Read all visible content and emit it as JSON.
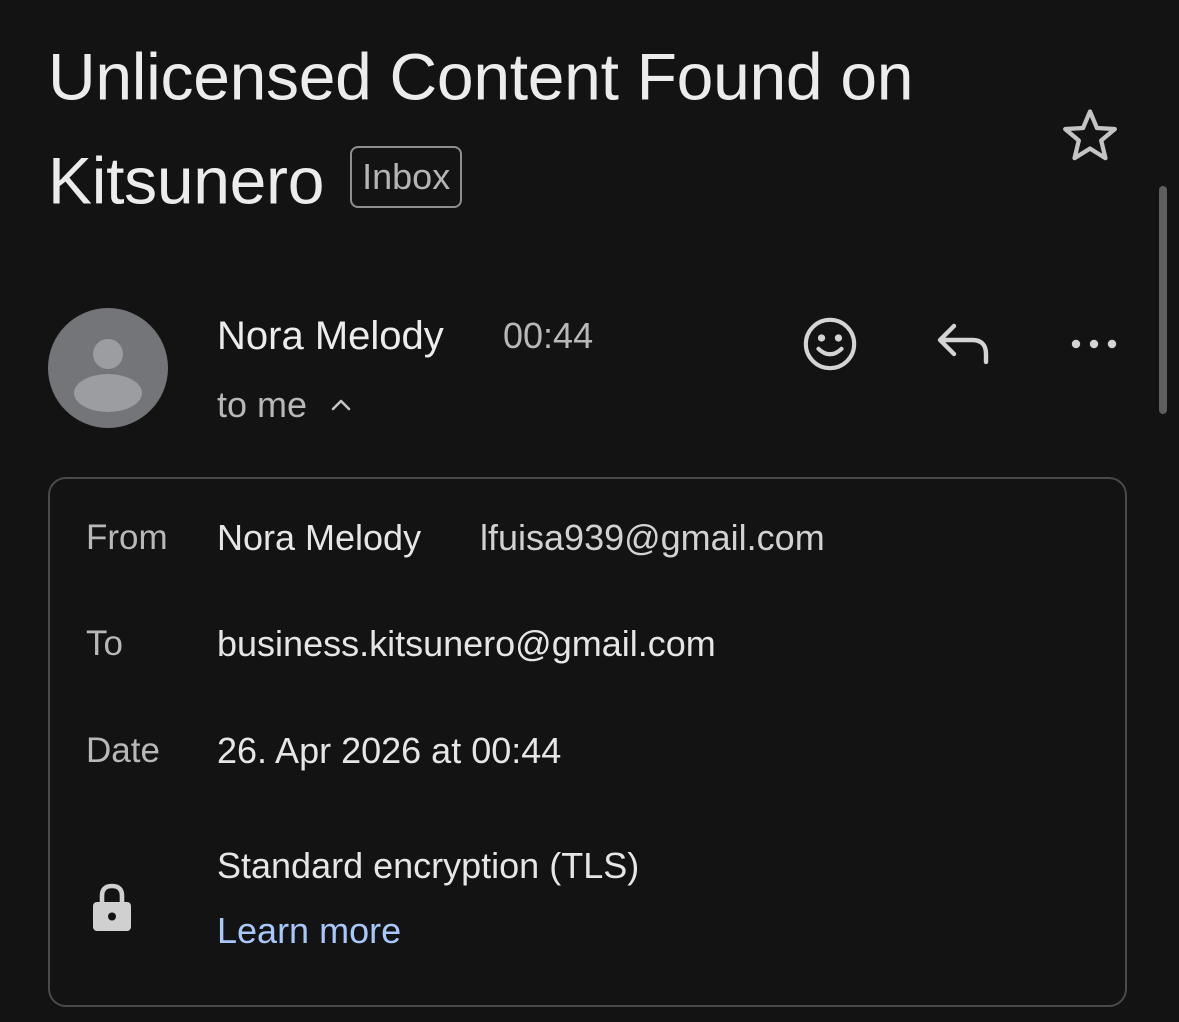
{
  "email": {
    "subject": "Unlicensed Content Found on Kitsunero",
    "label": "Inbox"
  },
  "sender": {
    "name": "Nora Melody",
    "time": "00:44",
    "recipient_summary": "to me"
  },
  "icons": {
    "star": "star-outline-icon",
    "avatar": "person-avatar-icon",
    "collapse": "chevron-up-icon",
    "react": "emoji-smile-icon",
    "reply": "reply-icon",
    "more": "more-horizontal-icon",
    "lock": "lock-icon"
  },
  "details": {
    "from_label": "From",
    "from_name": "Nora Melody",
    "from_email": "lfuisa939@gmail.com",
    "to_label": "To",
    "to_email": "business.kitsunero@gmail.com",
    "date_label": "Date",
    "date_value": "26. Apr 2026 at 00:44",
    "encryption": "Standard encryption (TLS)",
    "learn_more": "Learn more"
  },
  "colors": {
    "background": "#131314",
    "text_primary": "#ececec",
    "text_secondary": "#b8b8b8",
    "link": "#a8c7fa",
    "avatar_bg": "#747578"
  }
}
